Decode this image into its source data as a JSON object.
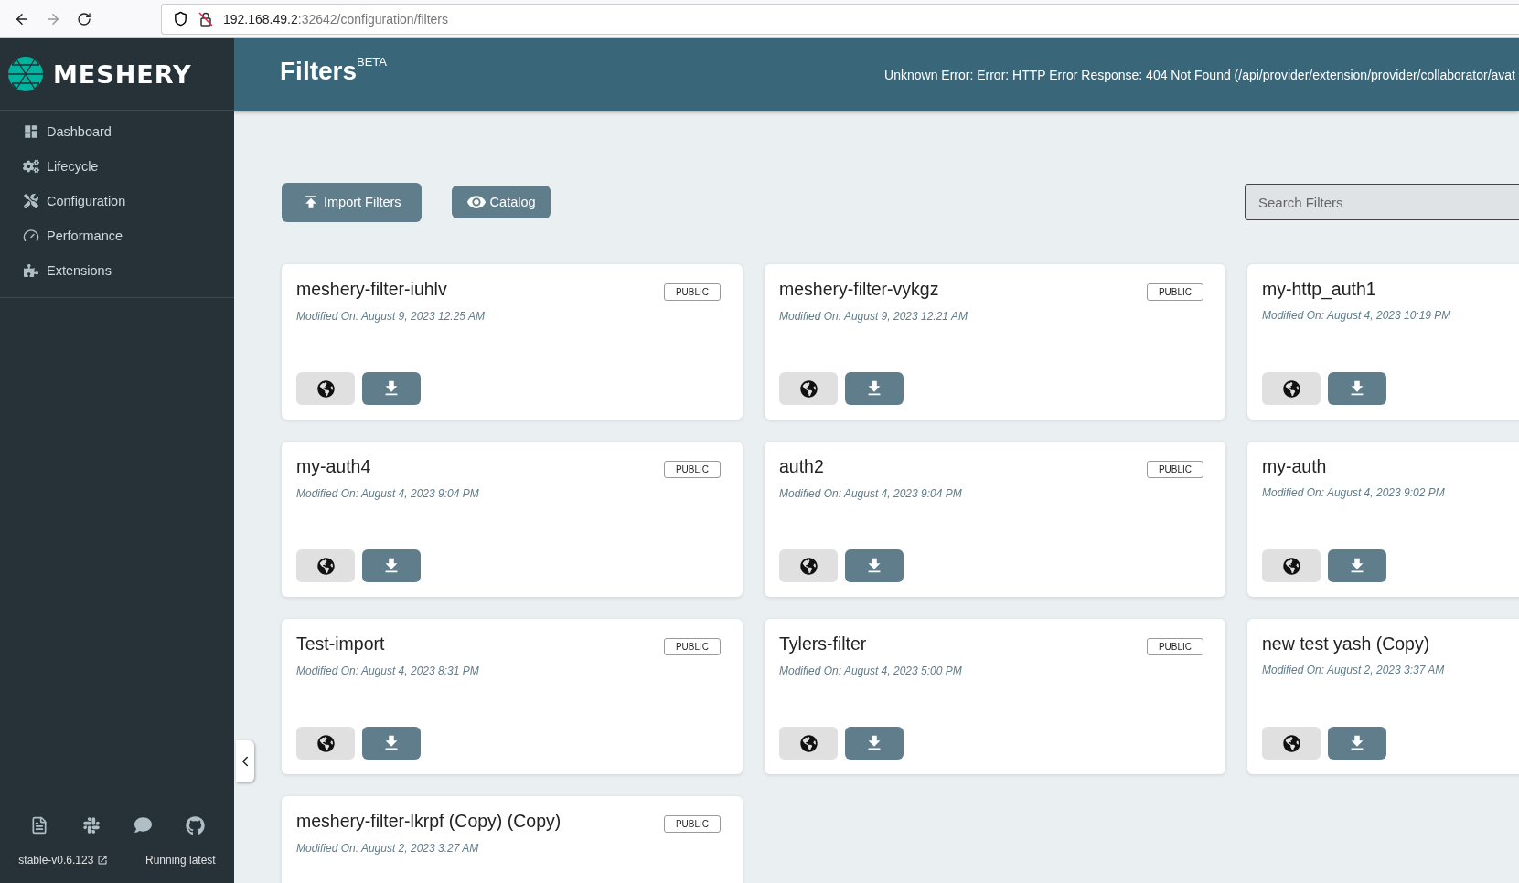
{
  "browser": {
    "url_host": "192.168.49.2",
    "url_path": ":32642/configuration/filters"
  },
  "sidebar": {
    "logo_text": "MESHERY",
    "items": [
      {
        "kind": "dashboard",
        "label": "Dashboard"
      },
      {
        "kind": "lifecycle",
        "label": "Lifecycle"
      },
      {
        "kind": "configuration",
        "label": "Configuration"
      },
      {
        "kind": "performance",
        "label": "Performance"
      },
      {
        "kind": "extensions",
        "label": "Extensions"
      }
    ],
    "footer": {
      "version": "stable-v0.6.123",
      "status": "Running latest"
    }
  },
  "header": {
    "title": "Filters",
    "title_sup": "BETA",
    "error": "Unknown Error: Error: HTTP Error Response: 404 Not Found (/api/provider/extension/provider/collaborator/avat"
  },
  "toolbar": {
    "import_button": "Import Filters",
    "catalog_button": "Catalog",
    "search": {
      "placeholder": "Search Filters"
    }
  },
  "cards": [
    {
      "name": "meshery-filter-iuhlv",
      "modified": "Modified On: August 9, 2023 12:25 AM",
      "badge": "PUBLIC"
    },
    {
      "name": "meshery-filter-vykgz",
      "modified": "Modified On: August 9, 2023 12:21 AM",
      "badge": "PUBLIC"
    },
    {
      "name": "my-http_auth1",
      "modified": "Modified On: August 4, 2023 10:19 PM"
    },
    {
      "name": "my-auth4",
      "modified": "Modified On: August 4, 2023 9:04 PM",
      "badge": "PUBLIC"
    },
    {
      "name": "auth2",
      "modified": "Modified On: August 4, 2023 9:04 PM",
      "badge": "PUBLIC"
    },
    {
      "name": "my-auth",
      "modified": "Modified On: August 4, 2023 9:02 PM"
    },
    {
      "name": "Test-import",
      "modified": "Modified On: August 4, 2023 8:31 PM",
      "badge": "PUBLIC"
    },
    {
      "name": "Tylers-filter",
      "modified": "Modified On: August 4, 2023 5:00 PM",
      "badge": "PUBLIC"
    },
    {
      "name": "new test yash (Copy)",
      "modified": "Modified On: August 2, 2023 3:37 AM"
    },
    {
      "name": "meshery-filter-lkrpf (Copy) (Copy)",
      "modified": "Modified On: August 2, 2023 3:27 AM",
      "badge": "PUBLIC",
      "actions_hidden": true
    }
  ]
}
